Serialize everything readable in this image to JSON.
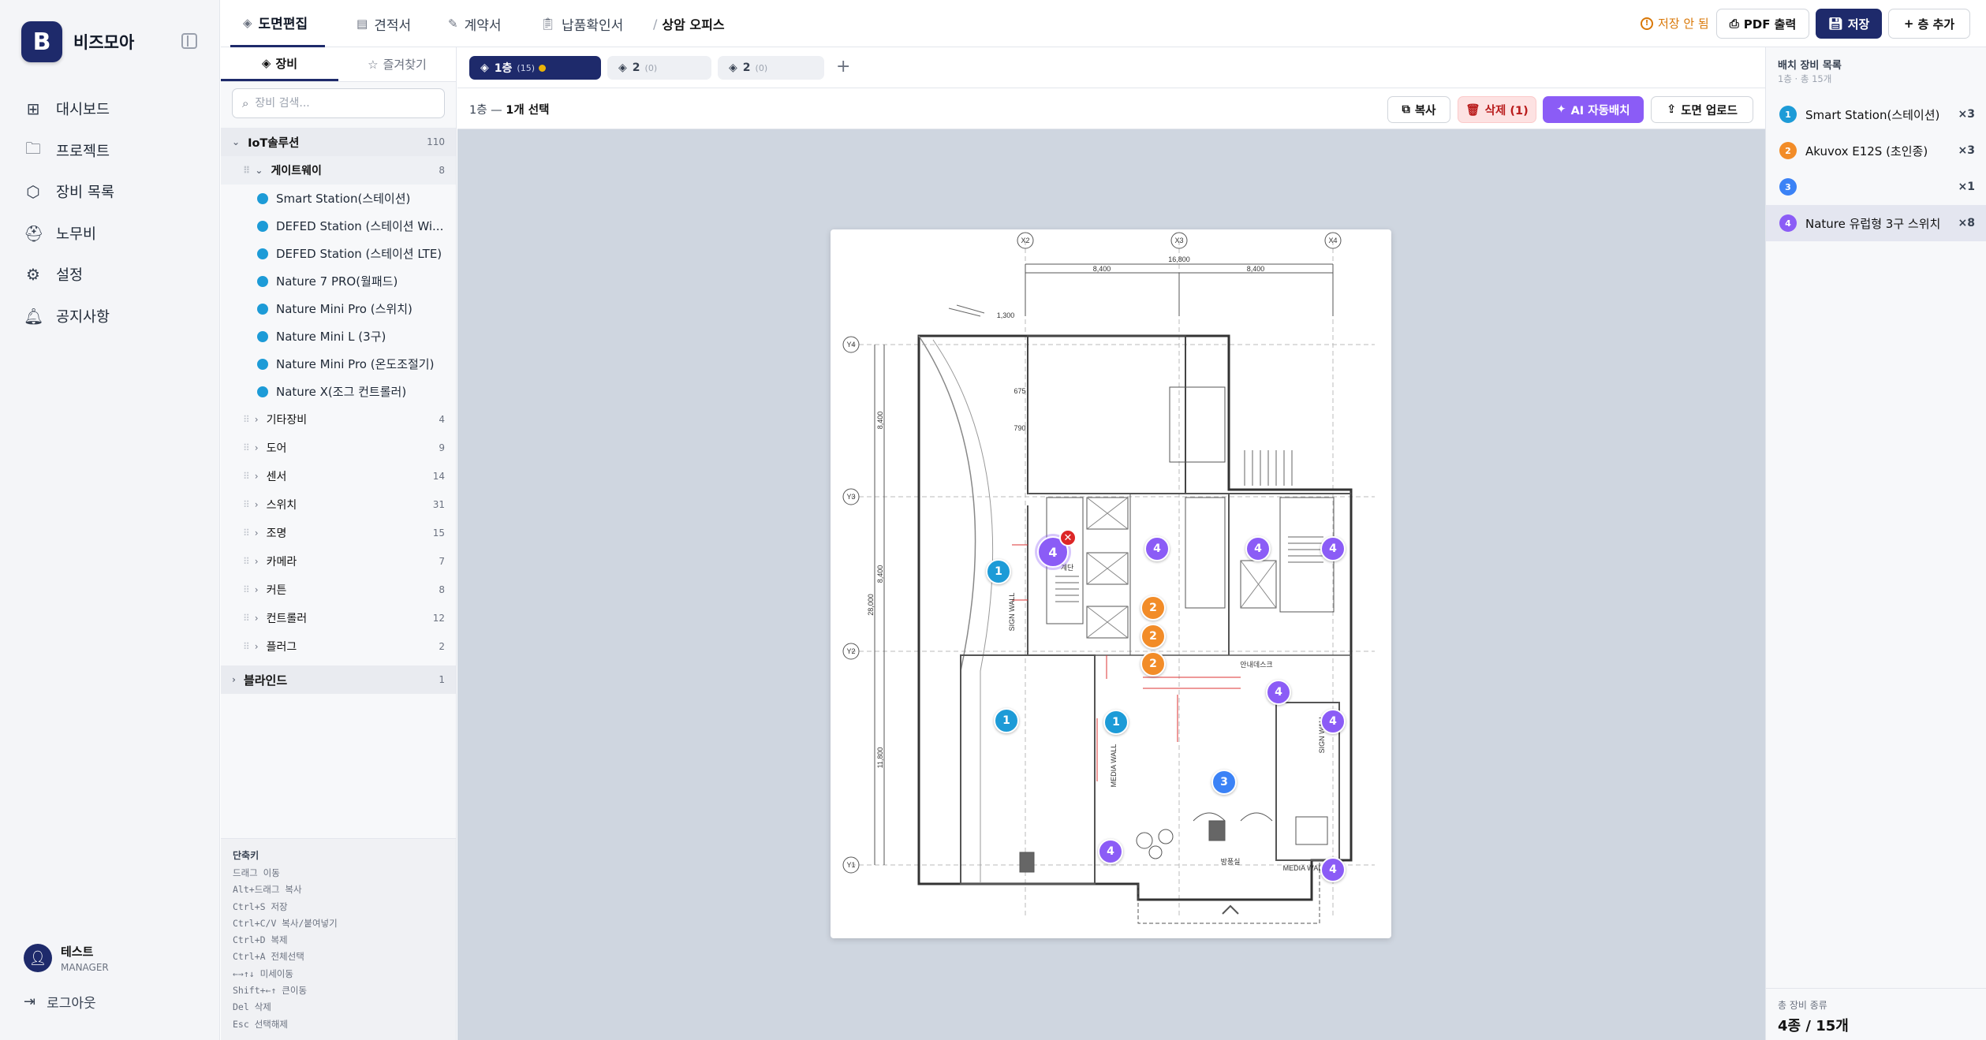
{
  "app": {
    "name": "비즈모아",
    "logo_letter": "B"
  },
  "nav": {
    "items": [
      {
        "label": "대시보드",
        "icon": "grid-icon"
      },
      {
        "label": "프로젝트",
        "icon": "folder-icon"
      },
      {
        "label": "장비 목록",
        "icon": "box-icon"
      },
      {
        "label": "노무비",
        "icon": "hardhat-icon"
      },
      {
        "label": "설정",
        "icon": "gear-icon"
      },
      {
        "label": "공지사항",
        "icon": "bell-icon"
      }
    ],
    "user": {
      "name": "테스트",
      "role": "MANAGER"
    },
    "logout": "로그아웃"
  },
  "topbar": {
    "tabs": [
      {
        "label": "도면편집",
        "active": true
      },
      {
        "label": "견적서"
      },
      {
        "label": "계약서"
      },
      {
        "label": "납품확인서"
      }
    ],
    "breadcrumb_sep": "/",
    "breadcrumb": "상암 오피스",
    "unsaved": "저장 안 됨",
    "pdf_button": "PDF 출력",
    "save_button": "저장",
    "add_floor_button": "층 추가"
  },
  "panel": {
    "tabs": {
      "equipment": "장비",
      "favorites": "즐겨찾기"
    },
    "search_placeholder": "장비 검색...",
    "group": {
      "label": "IoT솔루션",
      "count": "110"
    },
    "gateway": {
      "label": "게이트웨이",
      "count": "8"
    },
    "items": [
      "Smart Station(스테이션)",
      "DEFED Station (스테이션 Wi...",
      "DEFED Station (스테이션 LTE)",
      "Nature 7 PRO(월패드)",
      "Nature Mini Pro (스위치)",
      "Nature Mini L (3구)",
      "Nature Mini Pro (온도조절기)",
      "Nature X(조그 컨트롤러)"
    ],
    "subgroups": [
      {
        "label": "기타장비",
        "count": "4"
      },
      {
        "label": "도어",
        "count": "9"
      },
      {
        "label": "센서",
        "count": "14"
      },
      {
        "label": "스위치",
        "count": "31"
      },
      {
        "label": "조명",
        "count": "15"
      },
      {
        "label": "카메라",
        "count": "7"
      },
      {
        "label": "커튼",
        "count": "8"
      },
      {
        "label": "컨트롤러",
        "count": "12"
      },
      {
        "label": "플러그",
        "count": "2"
      }
    ],
    "group2": {
      "label": "블라인드",
      "count": "1"
    },
    "shortcuts_title": "단축키",
    "shortcuts": [
      "드래그 이동",
      "Alt+드래그 복사",
      "Ctrl+S 저장",
      "Ctrl+C/V 복사/붙여넣기",
      "Ctrl+D 복제",
      "Ctrl+A 전체선택",
      "←→↑↓ 미세이동",
      "Shift+←↑ 큰이동",
      "Del 삭제",
      "Esc 선택해제"
    ]
  },
  "floors": [
    {
      "label": "1층",
      "count": "(15)",
      "active": true,
      "dirty": true
    },
    {
      "label": "2",
      "count": "(0)"
    },
    {
      "label": "2",
      "count": "(0)"
    }
  ],
  "toolbar": {
    "selection_floor": "1층 —",
    "selection_count": "1개 선택",
    "copy": "복사",
    "delete": "삭제 (1)",
    "ai": "AI 자동배치",
    "upload": "도면 업로드"
  },
  "markers": {
    "m1": "1",
    "m2": "2",
    "m3": "3",
    "m4": "4"
  },
  "floorplan_labels": {
    "axes": [
      "X2",
      "X3",
      "X4",
      "Y4",
      "Y3",
      "Y2",
      "Y1"
    ],
    "dim_top": "16,800",
    "dim_a": "8,400",
    "dim_b": "8,400",
    "dim_left_total": "28,000",
    "dim_l1": "8,400",
    "dim_l2": "8,400",
    "dim_l3": "11,800",
    "dim_small": "1,300",
    "dim_790": "790",
    "dim_675": "675",
    "sign_wall": "SIGN WALL",
    "sign_wall_2": "SIGN WALL",
    "media_wall": "MEDIA WALL",
    "media_wall_2": "MEDIA WALL",
    "room": "방풍실",
    "lobby": "안내데스크",
    "stair_tag": "계단"
  },
  "rpanel": {
    "title": "배치 장비 목록",
    "subtitle": "1층 · 총 15개",
    "items": [
      {
        "n": "1",
        "name": "Smart Station(스테이션)",
        "qty": "×3",
        "color": "#1d9bd7"
      },
      {
        "n": "2",
        "name": "Akuvox E12S (초인종)",
        "qty": "×3",
        "color": "#f28c28"
      },
      {
        "n": "3",
        "name": "",
        "qty": "×1",
        "color": "#3b82f6"
      },
      {
        "n": "4",
        "name": "Nature 유럽형 3구 스위치",
        "qty": "×8",
        "color": "#8b5cf6"
      }
    ],
    "footer_label": "총 장비 종류",
    "footer_value": "4종 / 15개"
  },
  "colors": {
    "brand": "#1e2a6b",
    "m1": "#1d9bd7",
    "m2": "#f28c28",
    "m3": "#3b82f6",
    "m4": "#8b5cf6",
    "danger": "#dc2626",
    "canvas_bg": "#cfd6e0"
  }
}
